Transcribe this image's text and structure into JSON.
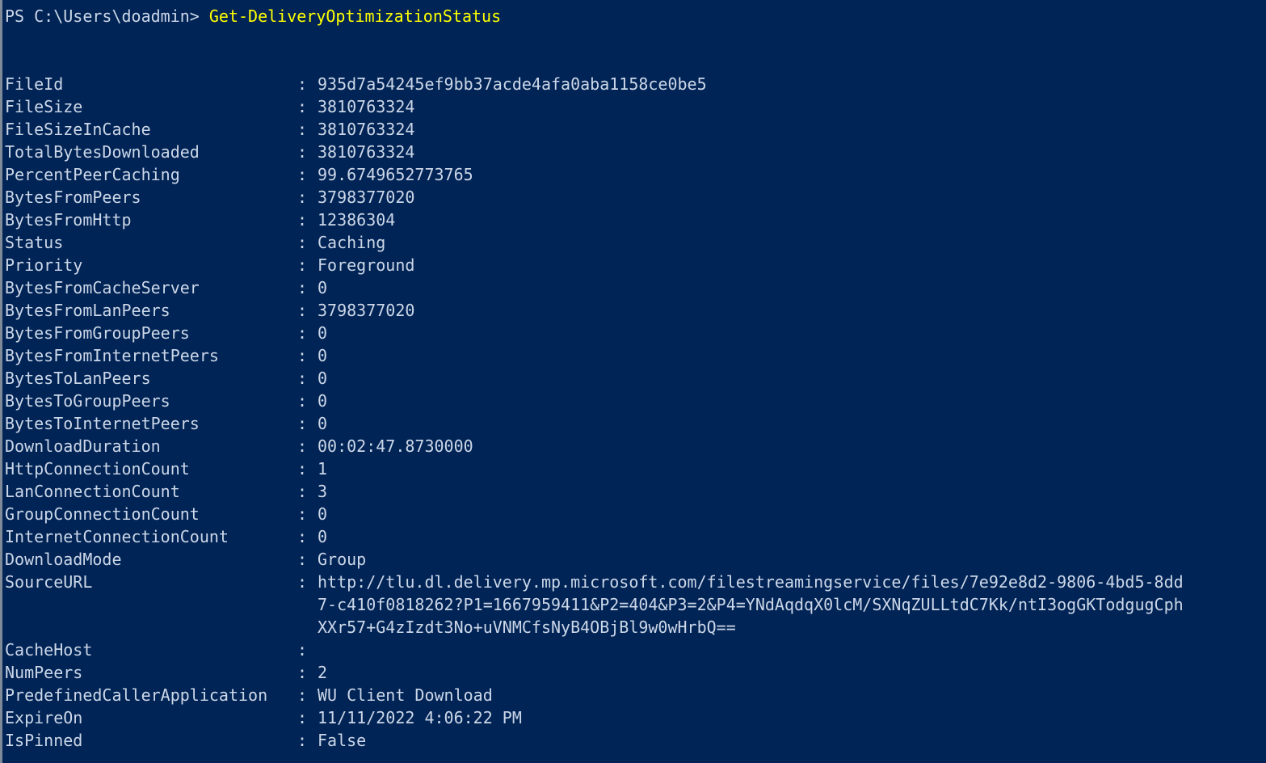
{
  "terminal": {
    "shell": "PowerShell",
    "background_color": "#012456",
    "foreground_color": "#ccd7e8",
    "command_color": "#ffff00",
    "prompt": "PS C:\\Users\\doadmin> ",
    "command": "Get-DeliveryOptimizationStatus",
    "separator": ":"
  },
  "output": {
    "rows": [
      {
        "key": "FileId",
        "value": "935d7a54245ef9bb37acde4afa0aba1158ce0be5"
      },
      {
        "key": "FileSize",
        "value": "3810763324"
      },
      {
        "key": "FileSizeInCache",
        "value": "3810763324"
      },
      {
        "key": "TotalBytesDownloaded",
        "value": "3810763324"
      },
      {
        "key": "PercentPeerCaching",
        "value": "99.6749652773765"
      },
      {
        "key": "BytesFromPeers",
        "value": "3798377020"
      },
      {
        "key": "BytesFromHttp",
        "value": "12386304"
      },
      {
        "key": "Status",
        "value": "Caching"
      },
      {
        "key": "Priority",
        "value": "Foreground"
      },
      {
        "key": "BytesFromCacheServer",
        "value": "0"
      },
      {
        "key": "BytesFromLanPeers",
        "value": "3798377020"
      },
      {
        "key": "BytesFromGroupPeers",
        "value": "0"
      },
      {
        "key": "BytesFromInternetPeers",
        "value": "0"
      },
      {
        "key": "BytesToLanPeers",
        "value": "0"
      },
      {
        "key": "BytesToGroupPeers",
        "value": "0"
      },
      {
        "key": "BytesToInternetPeers",
        "value": "0"
      },
      {
        "key": "DownloadDuration",
        "value": "00:02:47.8730000"
      },
      {
        "key": "HttpConnectionCount",
        "value": "1"
      },
      {
        "key": "LanConnectionCount",
        "value": "3"
      },
      {
        "key": "GroupConnectionCount",
        "value": "0"
      },
      {
        "key": "InternetConnectionCount",
        "value": "0"
      },
      {
        "key": "DownloadMode",
        "value": "Group"
      },
      {
        "key": "SourceURL",
        "value": "http://tlu.dl.delivery.mp.microsoft.com/filestreamingservice/files/7e92e8d2-9806-4bd5-8dd",
        "continuation": [
          "7-c410f0818262?P1=1667959411&P2=404&P3=2&P4=YNdAqdqX0lcM/SXNqZULLtdC7Kk/ntI3ogGKTodgugCph",
          "XXr57+G4zIzdt3No+uVNMCfsNyB4OBjBl9w0wHrbQ=="
        ]
      },
      {
        "key": "CacheHost",
        "value": ""
      },
      {
        "key": "NumPeers",
        "value": "2"
      },
      {
        "key": "PredefinedCallerApplication",
        "value": "WU Client Download"
      },
      {
        "key": "ExpireOn",
        "value": "11/11/2022 4:06:22 PM"
      },
      {
        "key": "IsPinned",
        "value": "False"
      }
    ]
  }
}
